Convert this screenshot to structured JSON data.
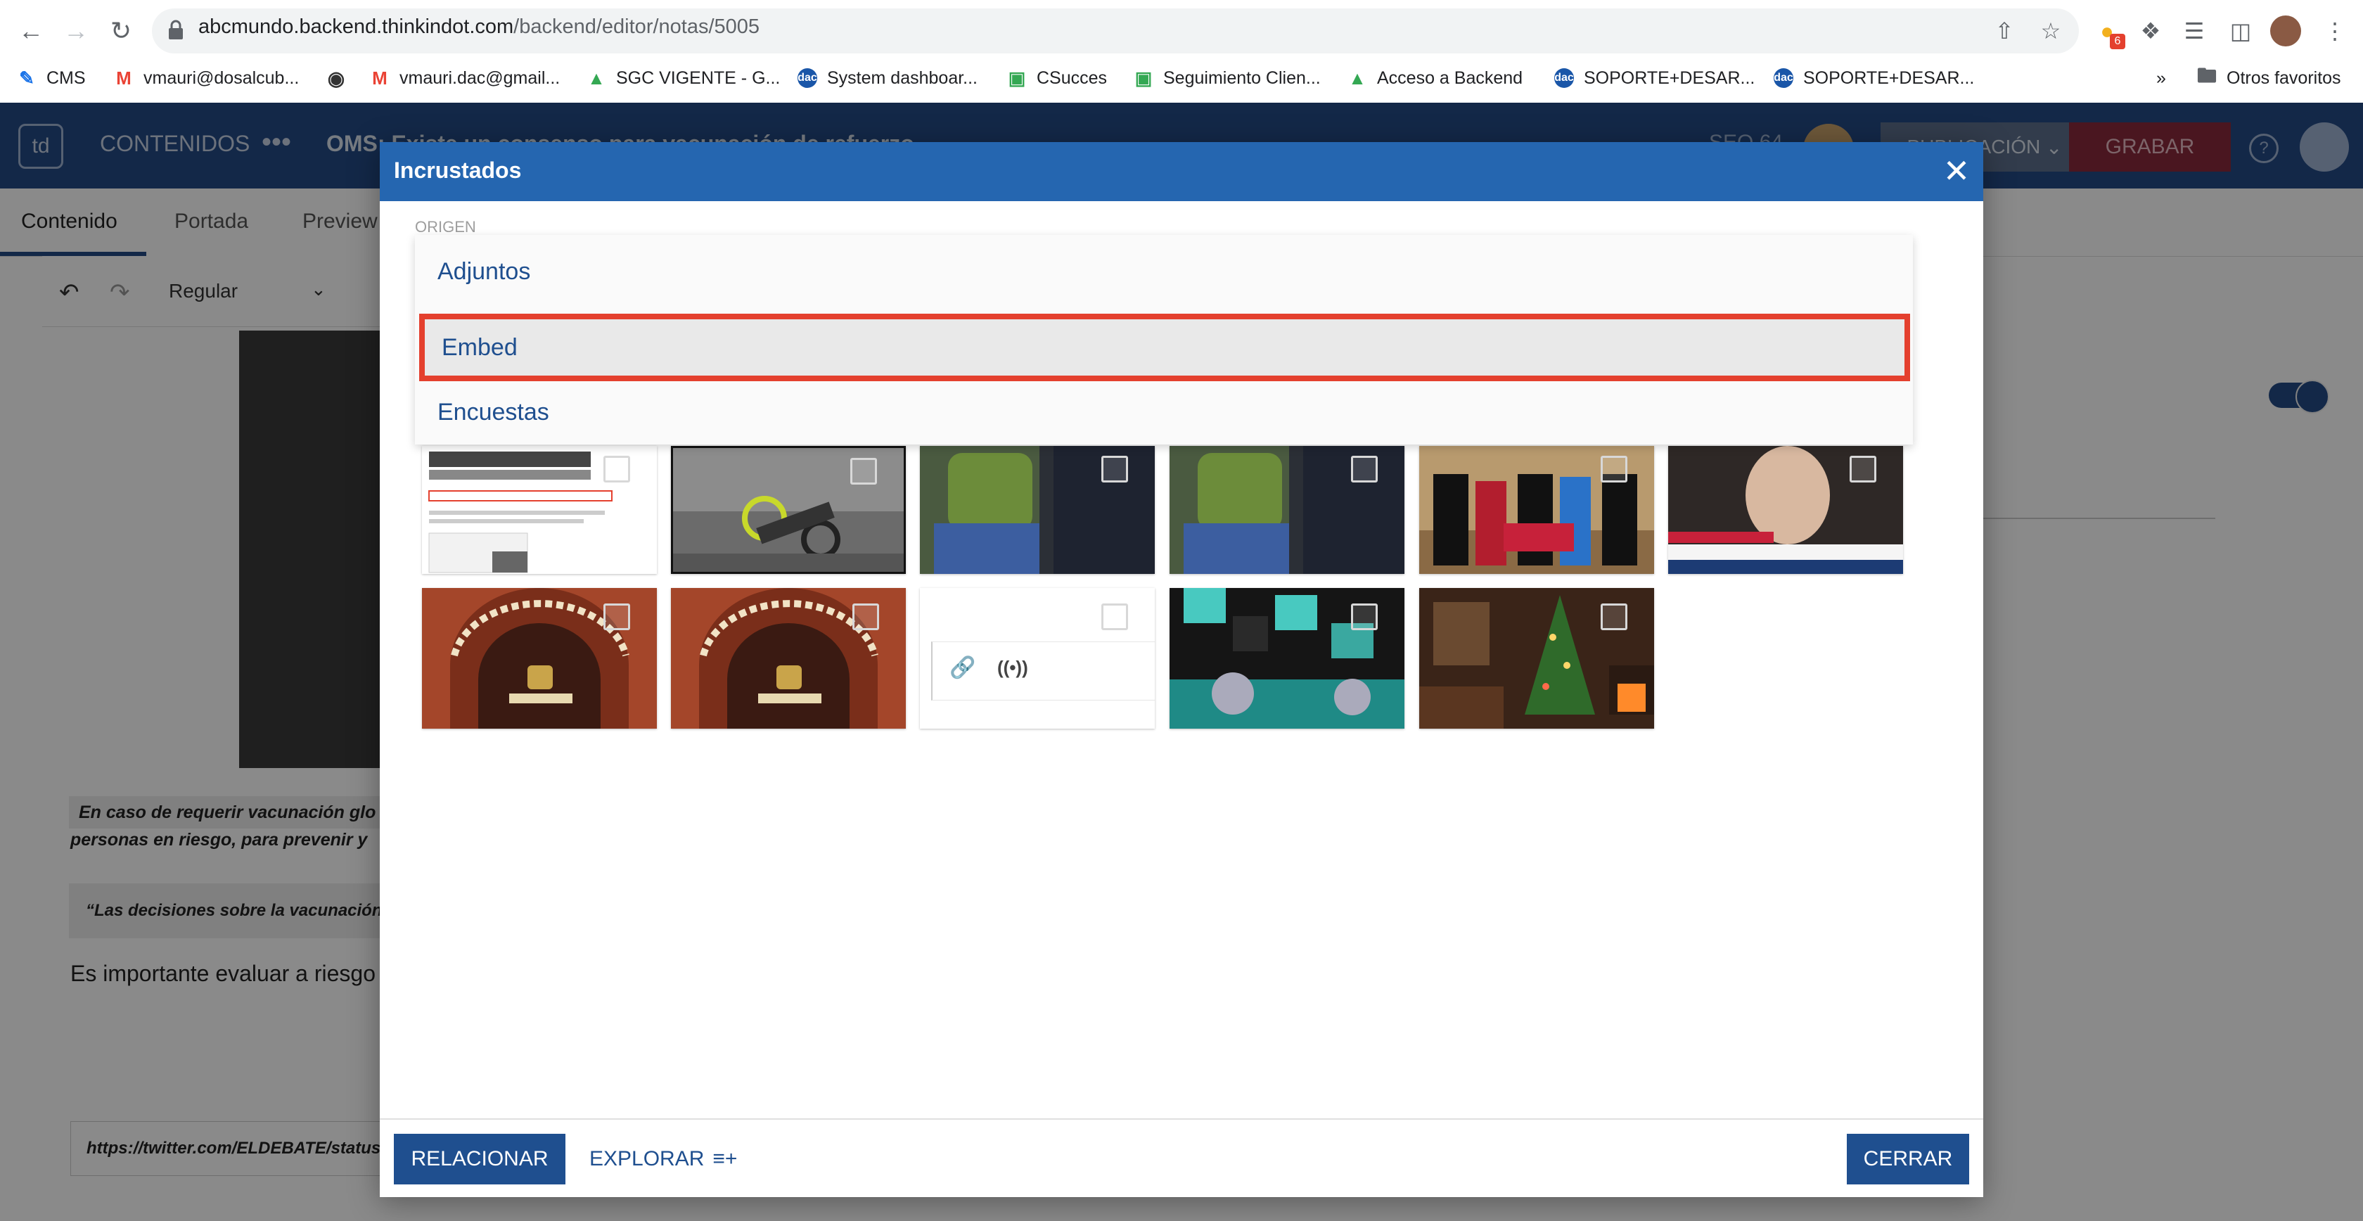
{
  "browser": {
    "url_host": "abcmundo.backend.thinkindot.com",
    "url_path": "/backend/editor/notas/5005",
    "extension_badge": "6"
  },
  "bookmarks": [
    {
      "label": "CMS",
      "icon": "edit-icon"
    },
    {
      "label": "vmauri@dosalcub...",
      "icon": "gmail-icon"
    },
    {
      "label": "",
      "icon": "globe-icon"
    },
    {
      "label": "vmauri.dac@gmail...",
      "icon": "gmail-icon"
    },
    {
      "label": "SGC VIGENTE - G...",
      "icon": "drive-icon"
    },
    {
      "label": "System dashboar...",
      "icon": "dac-icon"
    },
    {
      "label": "CSucces",
      "icon": "meet-icon"
    },
    {
      "label": "Seguimiento Clien...",
      "icon": "meet-icon"
    },
    {
      "label": "Acceso a Backend",
      "icon": "drive-icon"
    },
    {
      "label": "SOPORTE+DESAR...",
      "icon": "dac-icon"
    },
    {
      "label": "SOPORTE+DESAR...",
      "icon": "dac-icon"
    },
    {
      "label": "»",
      "icon": ""
    },
    {
      "label": "Otros favoritos",
      "icon": "folder-icon"
    }
  ],
  "app": {
    "logo": "td",
    "nav_label": "CONTENIDOS",
    "dots": "•••",
    "title": "OMS: Existe un consenso para vacunación de refuerzo",
    "seo": "SEO 64",
    "status_button": "PUBLICACIÓN",
    "save_button": "GRABAR"
  },
  "tabs": [
    "Contenido",
    "Portada",
    "Preview"
  ],
  "editor": {
    "style_select": "Regular",
    "quote1_line1": "En caso de requerir vacunación glo",
    "quote1_line2": "personas en riesgo, para prevenir y",
    "quote2": "“Las decisiones sobre la vacunación y",
    "paragraph": "Es importante evaluar a riesgo",
    "tweet_url": "https://twitter.com/ELDEBATE/status"
  },
  "modal": {
    "title": "Incrustados",
    "origin_label": "ORIGEN",
    "options": [
      "Adjuntos",
      "Embed",
      "Encuestas"
    ],
    "selected_option": "Embed",
    "highlight_color": "#e4402e",
    "footer": {
      "relate_button": "RELACIONAR",
      "explore_button": "EXPLORAR",
      "close_button": "CERRAR"
    }
  },
  "thumbnails": [
    {
      "name": "screenshot-doc",
      "checked": false
    },
    {
      "name": "motorcycle-stunt",
      "checked": false
    },
    {
      "name": "woman-green-sweater-1",
      "checked": false
    },
    {
      "name": "woman-green-sweater-2",
      "checked": false
    },
    {
      "name": "academic-ceremony",
      "checked": false
    },
    {
      "name": "tv-statue-broadcast",
      "checked": false
    },
    {
      "name": "correos-telegrafos-1",
      "checked": false
    },
    {
      "name": "correos-telegrafos-2",
      "checked": false
    },
    {
      "name": "embed-link-card",
      "checked": false
    },
    {
      "name": "teal-cubes-spheres",
      "checked": false
    },
    {
      "name": "christmas-tree-room",
      "checked": false
    }
  ],
  "colors": {
    "header_blue": "#234a86",
    "modal_header": "#2566b0",
    "button_blue": "#1f4f8f"
  }
}
